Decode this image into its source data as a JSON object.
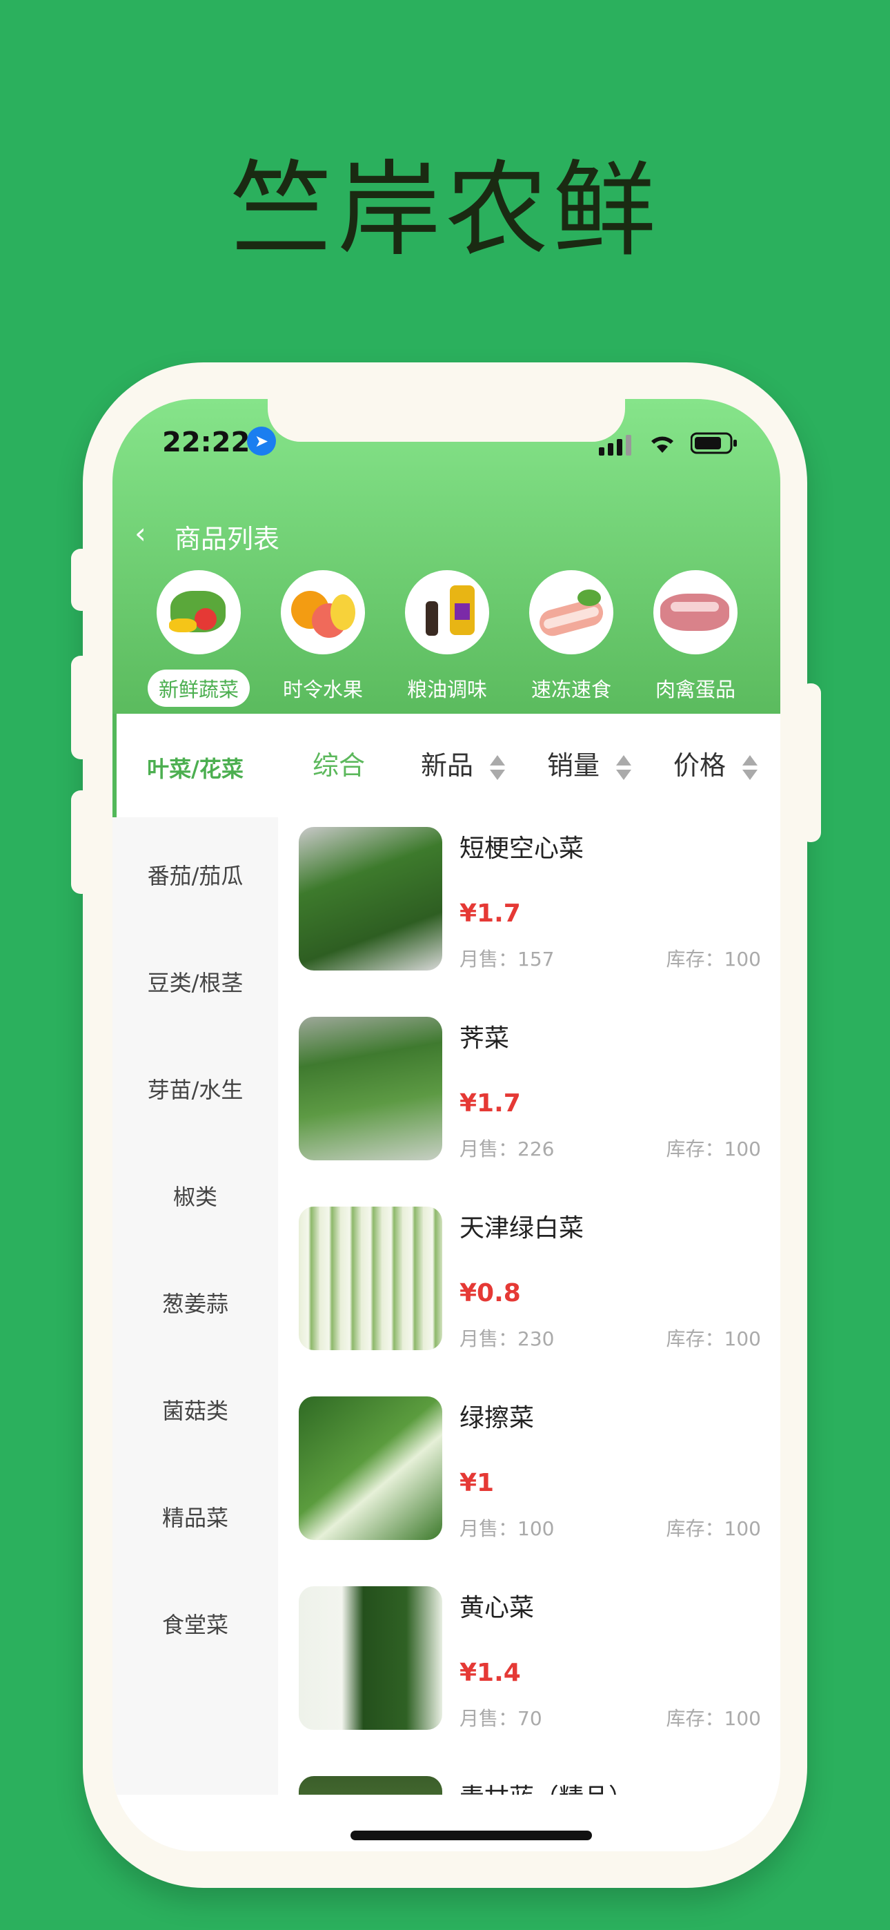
{
  "headline": "竺岸农鲜",
  "status": {
    "time": "22:22"
  },
  "header": {
    "back_icon": "chevron-left-icon",
    "title": "商品列表"
  },
  "categories": [
    {
      "label": "新鲜蔬菜",
      "active": true
    },
    {
      "label": "时令水果",
      "active": false
    },
    {
      "label": "粮油调味",
      "active": false
    },
    {
      "label": "速冻速食",
      "active": false
    },
    {
      "label": "肉禽蛋品",
      "active": false
    }
  ],
  "sidebar": {
    "items": [
      "叶菜/花菜",
      "番茄/茄瓜",
      "豆类/根茎",
      "芽苗/水生",
      "椒类",
      "葱姜蒜",
      "菌菇类",
      "精品菜",
      "食堂菜"
    ]
  },
  "sort": {
    "items": [
      "综合",
      "新品",
      "销量",
      "价格"
    ]
  },
  "products": [
    {
      "name": "短梗空心菜",
      "price": "¥1.7",
      "sold": "月售：157",
      "stock": "库存：100"
    },
    {
      "name": "荠菜",
      "price": "¥1.7",
      "sold": "月售：226",
      "stock": "库存：100"
    },
    {
      "name": "天津绿白菜",
      "price": "¥0.8",
      "sold": "月售：230",
      "stock": "库存：100"
    },
    {
      "name": "绿擦菜",
      "price": "¥1",
      "sold": "月售：100",
      "stock": "库存：100"
    },
    {
      "name": "黄心菜",
      "price": "¥1.4",
      "sold": "月售：70",
      "stock": "库存：100"
    },
    {
      "name": "青甘蓝（精品）"
    }
  ],
  "colors": {
    "brand_green": "#2bb05d",
    "accent_green": "#4caf50",
    "price_red": "#e53935"
  }
}
